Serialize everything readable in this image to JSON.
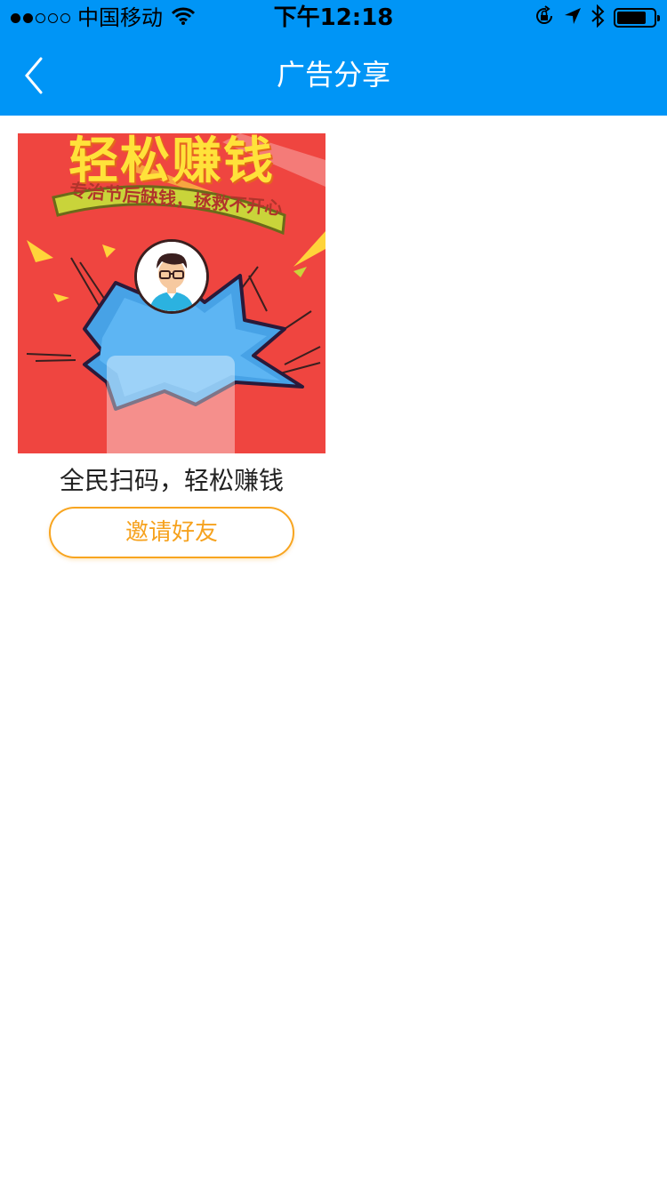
{
  "status_bar": {
    "carrier": "中国移动",
    "time": "下午12:18",
    "icons": [
      "signal-dots-icon",
      "wifi-icon",
      "orientation-lock-icon",
      "location-arrow-icon",
      "bluetooth-icon",
      "battery-icon"
    ],
    "battery_level": 0.8
  },
  "nav": {
    "title": "广告分享",
    "back_icon": "chevron-left-icon"
  },
  "colors": {
    "header_bg": "#0095f6",
    "accent": "#f6a21e",
    "poster_bg": "#ef4540"
  },
  "cards": [
    {
      "poster": {
        "headline": "轻松赚钱",
        "ribbon": "专治节后缺钱，拯救不开心"
      },
      "title": "全民扫码，轻松赚钱",
      "button": "邀请好友"
    }
  ]
}
